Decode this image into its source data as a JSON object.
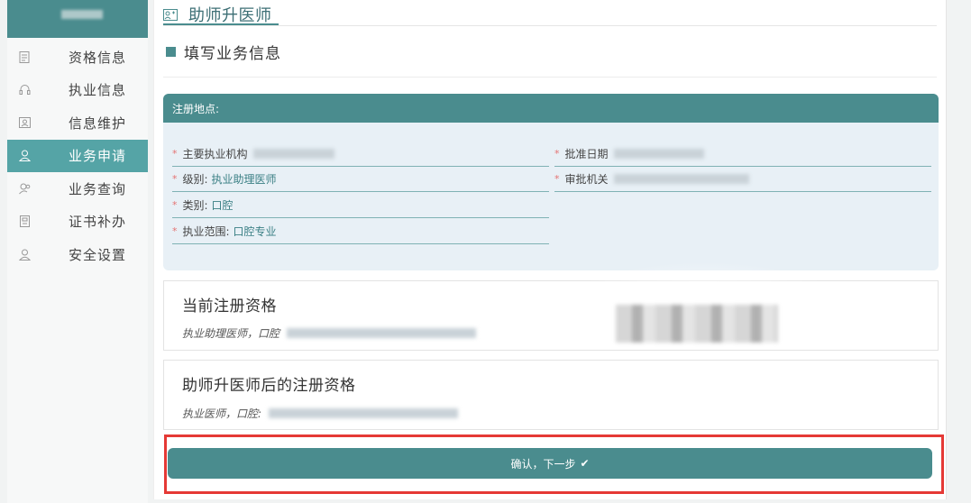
{
  "sidebar": {
    "items": [
      {
        "label": "资格信息",
        "icon": "document-icon"
      },
      {
        "label": "执业信息",
        "icon": "headset-icon"
      },
      {
        "label": "信息维护",
        "icon": "id-card-icon"
      },
      {
        "label": "业务申请",
        "icon": "user-icon",
        "active": true
      },
      {
        "label": "业务查询",
        "icon": "user-search-icon"
      },
      {
        "label": "证书补办",
        "icon": "certificate-icon"
      },
      {
        "label": "安全设置",
        "icon": "user-shield-icon"
      }
    ]
  },
  "page": {
    "title": "助师升医师"
  },
  "section": {
    "title": "填写业务信息"
  },
  "registration": {
    "header": "注册地点:",
    "fields": {
      "institution_label": "主要执业机构",
      "level_label": "级别:",
      "level_value": "执业助理医师",
      "category_label": "类别:",
      "category_value": "口腔",
      "scope_label": "执业范围:",
      "scope_value": "口腔专业",
      "approve_date_label": "批准日期",
      "approve_org_label": "审批机关"
    }
  },
  "current_qual": {
    "title": "当前注册资格",
    "line": "执业助理医师，口腔"
  },
  "after_qual": {
    "title": "助师升医师后的注册资格",
    "line": "执业医师，口腔:"
  },
  "confirm": {
    "label": "确认，下一步",
    "check": "✔"
  },
  "colors": {
    "accent": "#4a8c8e",
    "active_nav": "#55a4a6",
    "highlight": "#e53935",
    "required": "#e57373"
  }
}
